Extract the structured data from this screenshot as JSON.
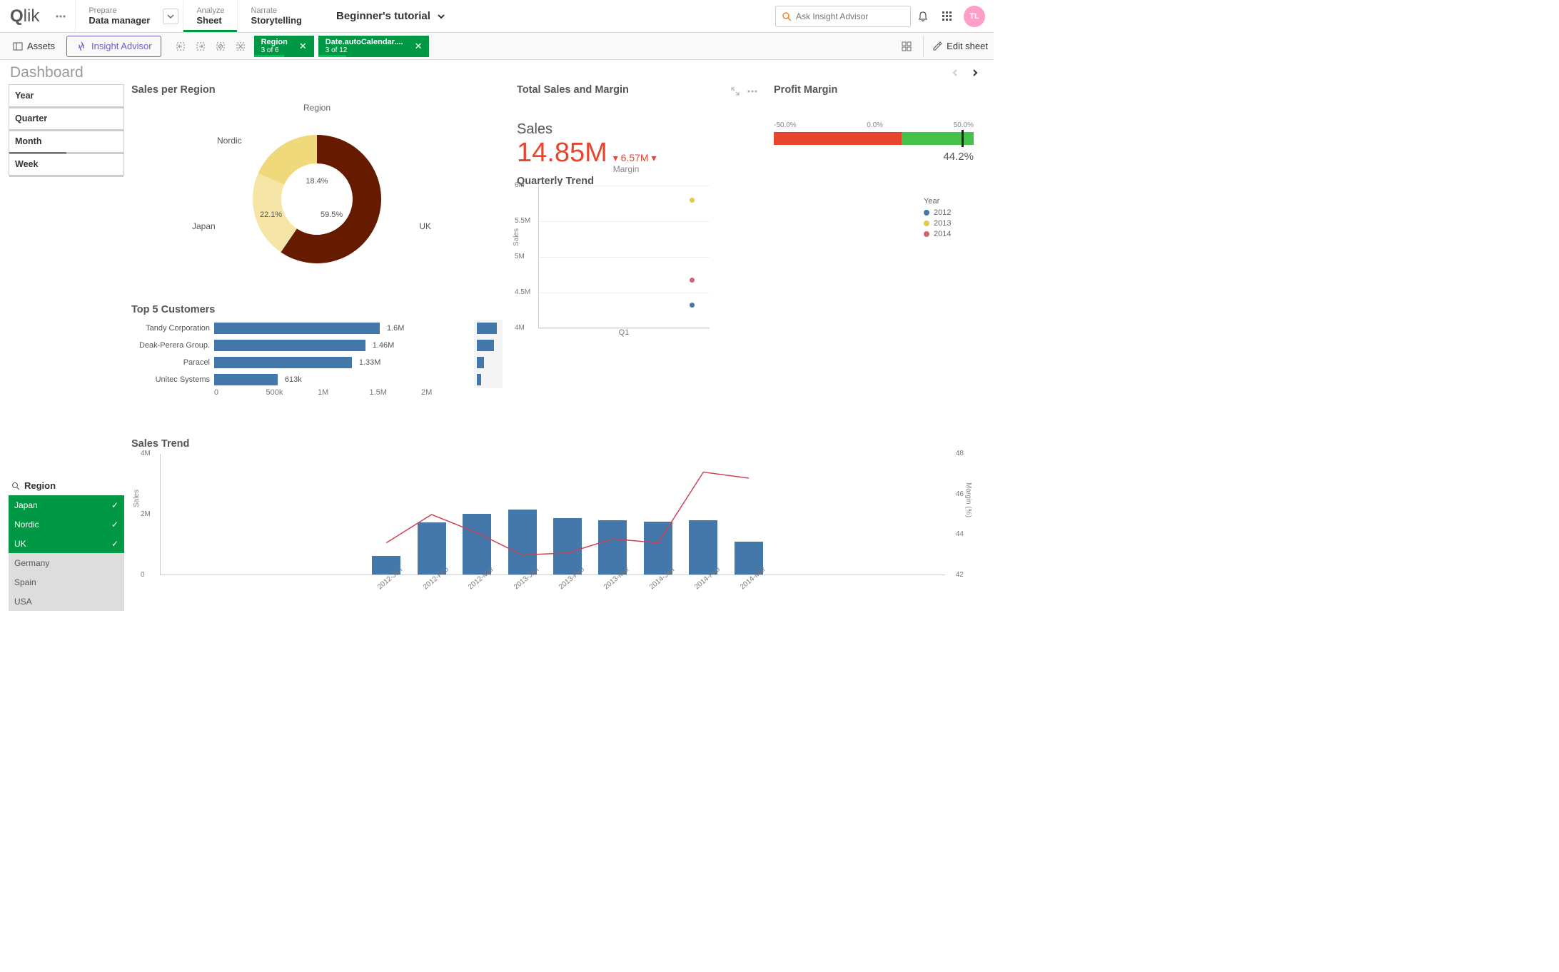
{
  "nav": {
    "prepare": {
      "small": "Prepare",
      "big": "Data manager"
    },
    "analyze": {
      "small": "Analyze",
      "big": "Sheet"
    },
    "narrate": {
      "small": "Narrate",
      "big": "Storytelling"
    }
  },
  "app_title": "Beginner's tutorial",
  "search_placeholder": "Ask Insight Advisor",
  "avatar": "TL",
  "toolbar": {
    "assets": "Assets",
    "insight": "Insight Advisor",
    "edit": "Edit sheet",
    "chips": [
      {
        "title": "Region",
        "sub": "3 of 6",
        "bar_pct": 50
      },
      {
        "title": "Date.autoCalendar....",
        "sub": "3 of 12",
        "bar_pct": 25
      }
    ]
  },
  "sheet_title": "Dashboard",
  "filters": [
    "Year",
    "Quarter",
    "Month",
    "Week"
  ],
  "region_filter": {
    "title": "Region",
    "items": [
      {
        "name": "Japan",
        "on": true
      },
      {
        "name": "Nordic",
        "on": true
      },
      {
        "name": "UK",
        "on": true
      },
      {
        "name": "Germany",
        "on": false
      },
      {
        "name": "Spain",
        "on": false
      },
      {
        "name": "USA",
        "on": false
      }
    ]
  },
  "chart_data": [
    {
      "id": "pie",
      "type": "pie",
      "title": "Sales per Region",
      "legend_title": "Region",
      "series": [
        {
          "name": "UK",
          "value": 59.5,
          "color": "#661a00"
        },
        {
          "name": "Japan",
          "value": 22.1,
          "color": "#f5e6a8"
        },
        {
          "name": "Nordic",
          "value": 18.4,
          "color": "#f0d97a"
        }
      ]
    },
    {
      "id": "kpi",
      "type": "table",
      "title": "Total Sales and Margin",
      "label": "Sales",
      "value": "14.85M",
      "secondary_value": "6.57M",
      "secondary_label": "Margin"
    },
    {
      "id": "bullet",
      "type": "bar",
      "title": "Profit Margin",
      "scale": [
        "-50.0%",
        "0.0%",
        "50.0%"
      ],
      "value": "44.2%",
      "segments": [
        {
          "from": 0,
          "to": 64,
          "color": "#e8452f"
        },
        {
          "from": 64,
          "to": 100,
          "color": "#44c24a"
        }
      ],
      "marker_pct": 94
    },
    {
      "id": "top5",
      "type": "bar",
      "title": "Top 5 Customers",
      "xticks": [
        "0",
        "500k",
        "1M",
        "1.5M",
        "2M"
      ],
      "max": 2000000,
      "rows": [
        {
          "name": "Tandy Corporation",
          "value": 1600000,
          "label": "1.6M",
          "mini": 28
        },
        {
          "name": "Deak-Perera Group.",
          "value": 1460000,
          "label": "1.46M",
          "mini": 24
        },
        {
          "name": "Paracel",
          "value": 1330000,
          "label": "1.33M",
          "mini": 10
        },
        {
          "name": "Unitec Systems",
          "value": 613000,
          "label": "613k",
          "mini": 6
        }
      ]
    },
    {
      "id": "quarterly",
      "type": "scatter",
      "title": "Quarterly Trend",
      "ylabel": "Sales",
      "yticks": [
        "4M",
        "4.5M",
        "5M",
        "5.5M",
        "6M"
      ],
      "ylim": [
        4000000,
        6000000
      ],
      "xlabel": "Q1",
      "legend_title": "Year",
      "series": [
        {
          "name": "2012",
          "color": "#4477aa",
          "points": [
            {
              "x": 1,
              "y": 4330000
            }
          ]
        },
        {
          "name": "2013",
          "color": "#e8c842",
          "points": [
            {
              "x": 1,
              "y": 5800000
            }
          ]
        },
        {
          "name": "2014",
          "color": "#cc6677",
          "points": [
            {
              "x": 1,
              "y": 4680000
            }
          ]
        }
      ]
    },
    {
      "id": "salestrend",
      "type": "bar",
      "title": "Sales Trend",
      "ylabel": "Sales",
      "y2label": "Margin (%)",
      "yticks": [
        "0",
        "2M",
        "4M"
      ],
      "y2ticks": [
        "42",
        "44",
        "46",
        "48"
      ],
      "ylim": [
        0,
        4000000
      ],
      "y2lim": [
        42,
        48
      ],
      "categories": [
        "2012-Jan",
        "2012-Feb",
        "2012-Mar",
        "2013-Jan",
        "2013-Feb",
        "2013-Mar",
        "2014-Jan",
        "2014-Feb",
        "2014-Mar"
      ],
      "bars": [
        620000,
        1720000,
        2010000,
        2130000,
        1870000,
        1790000,
        1750000,
        1790000,
        1090000
      ],
      "line_y": [
        43.6,
        45.0,
        44.1,
        43.0,
        43.1,
        43.8,
        43.6,
        47.1,
        46.8
      ]
    }
  ]
}
